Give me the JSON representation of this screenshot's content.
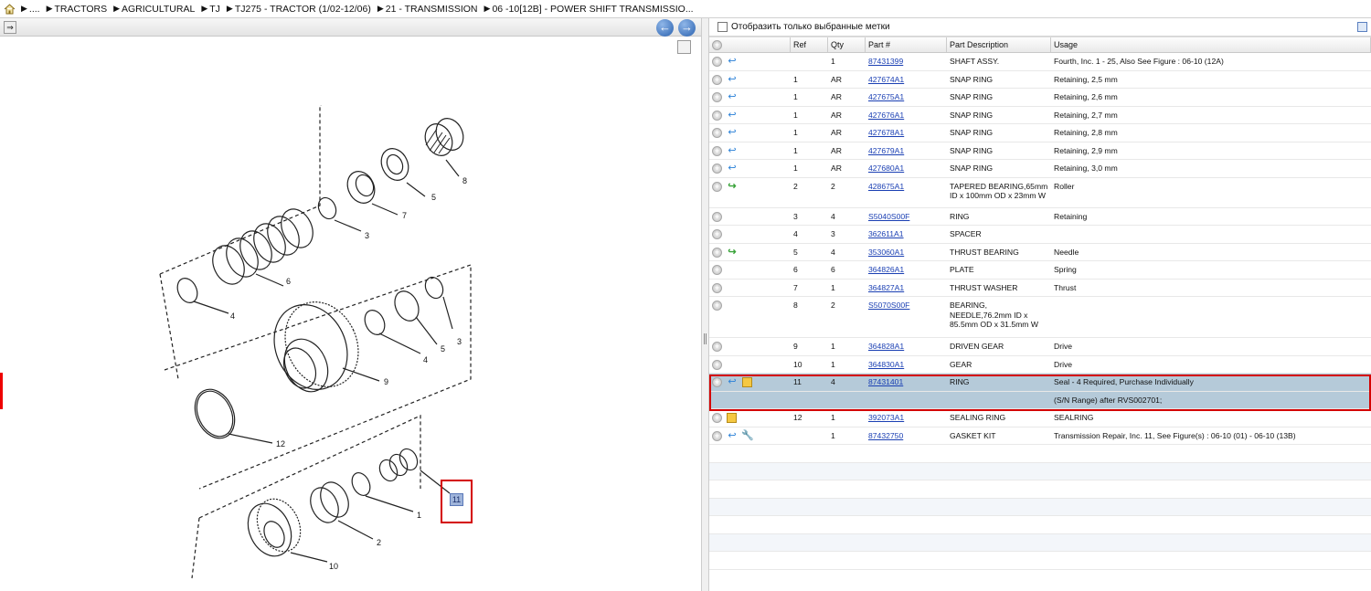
{
  "breadcrumb": [
    {
      "label": "...."
    },
    {
      "label": "TRACTORS"
    },
    {
      "label": "AGRICULTURAL"
    },
    {
      "label": "TJ"
    },
    {
      "label": "TJ275 - TRACTOR (1/02-12/06)"
    },
    {
      "label": "21 - TRANSMISSION"
    },
    {
      "label": "06 -10[12B] - POWER SHIFT TRANSMISSIO..."
    }
  ],
  "diagram": {
    "callout_badge": "11",
    "labels": {
      "l1": "1",
      "l2": "2",
      "l3a": "3",
      "l3b": "3",
      "l4a": "4",
      "l4b": "4",
      "l5a": "5",
      "l5b": "5",
      "l6": "6",
      "l7": "7",
      "l8": "8",
      "l9": "9",
      "l10": "10",
      "l12": "12"
    }
  },
  "filter": {
    "label": "Отобразить только выбранные метки"
  },
  "columns": {
    "ref": "Ref",
    "qty": "Qty",
    "part": "Part #",
    "desc": "Part Description",
    "usage": "Usage"
  },
  "rows": [
    {
      "ref": "",
      "qty": "1",
      "part": "87431399",
      "desc": "SHAFT ASSY.",
      "usage": "Fourth, Inc. 1 - 25, Also See Figure : 06-10 (12A)",
      "icon": "blue"
    },
    {
      "ref": "1",
      "qty": "AR",
      "part": "427674A1",
      "desc": "SNAP RING",
      "usage": "Retaining, 2,5 mm",
      "icon": "blue"
    },
    {
      "ref": "1",
      "qty": "AR",
      "part": "427675A1",
      "desc": "SNAP RING",
      "usage": "Retaining, 2,6 mm",
      "icon": "blue"
    },
    {
      "ref": "1",
      "qty": "AR",
      "part": "427676A1",
      "desc": "SNAP RING",
      "usage": "Retaining, 2,7 mm",
      "icon": "blue"
    },
    {
      "ref": "1",
      "qty": "AR",
      "part": "427678A1",
      "desc": "SNAP RING",
      "usage": "Retaining, 2,8 mm",
      "icon": "blue"
    },
    {
      "ref": "1",
      "qty": "AR",
      "part": "427679A1",
      "desc": "SNAP RING",
      "usage": "Retaining, 2,9 mm",
      "icon": "blue"
    },
    {
      "ref": "1",
      "qty": "AR",
      "part": "427680A1",
      "desc": "SNAP RING",
      "usage": "Retaining, 3,0 mm",
      "icon": "blue"
    },
    {
      "ref": "2",
      "qty": "2",
      "part": "428675A1",
      "desc": "TAPERED BEARING,65mm ID x 100mm OD x 23mm W",
      "usage": "Roller",
      "icon": "green",
      "tall": true
    },
    {
      "ref": "3",
      "qty": "4",
      "part": "S5040S00F",
      "desc": "RING",
      "usage": "Retaining",
      "icon": ""
    },
    {
      "ref": "4",
      "qty": "3",
      "part": "362611A1",
      "desc": "SPACER",
      "usage": "",
      "icon": ""
    },
    {
      "ref": "5",
      "qty": "4",
      "part": "353060A1",
      "desc": "THRUST BEARING",
      "usage": "Needle",
      "icon": "green"
    },
    {
      "ref": "6",
      "qty": "6",
      "part": "364826A1",
      "desc": "PLATE",
      "usage": "Spring",
      "icon": ""
    },
    {
      "ref": "7",
      "qty": "1",
      "part": "364827A1",
      "desc": "THRUST WASHER",
      "usage": "Thrust",
      "icon": ""
    },
    {
      "ref": "8",
      "qty": "2",
      "part": "S5070S00F",
      "desc": "BEARING, NEEDLE,76.2mm ID x 85.5mm OD x 31.5mm W",
      "usage": "",
      "icon": "",
      "tall3": true
    },
    {
      "ref": "9",
      "qty": "1",
      "part": "364828A1",
      "desc": "DRIVEN GEAR",
      "usage": "Drive",
      "icon": ""
    },
    {
      "ref": "10",
      "qty": "1",
      "part": "364830A1",
      "desc": "GEAR",
      "usage": "Drive",
      "icon": ""
    },
    {
      "ref": "11",
      "qty": "4",
      "part": "87431401",
      "desc": "RING",
      "usage": "Seal - 4 Required, Purchase Individually",
      "usage2": "(S/N Range) after RVS002701;",
      "icon": "bluebox",
      "selected": true
    },
    {
      "ref": "12",
      "qty": "1",
      "part": "392073A1",
      "desc": "SEALING RING",
      "usage": "SEALRING",
      "icon": "box"
    },
    {
      "ref": "",
      "qty": "1",
      "part": "87432750",
      "desc": "GASKET KIT",
      "usage": "Transmission Repair, Inc. 11, See Figure(s) : 06-10 (01) - 06-10 (13B)",
      "icon": "bluewrench"
    }
  ]
}
